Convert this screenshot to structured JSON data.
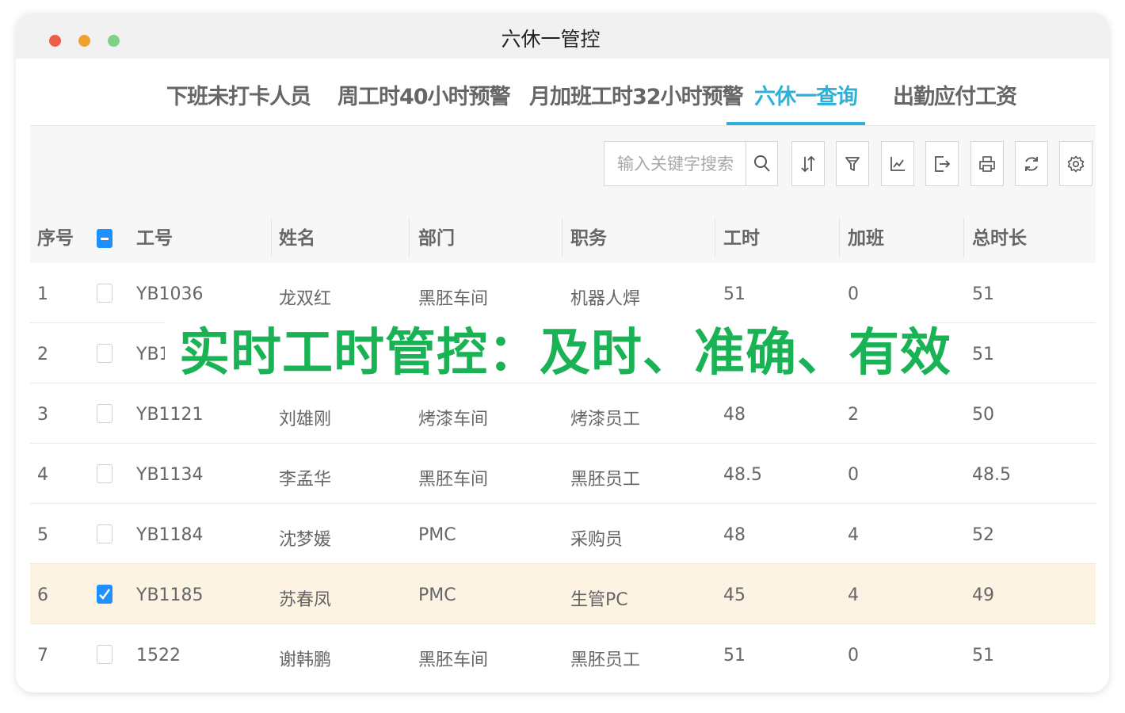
{
  "window": {
    "title": "六休一管控"
  },
  "tabs": [
    {
      "label": "下班未打卡人员",
      "active": false
    },
    {
      "label": "周工时40小时预警",
      "active": false
    },
    {
      "label": "月加班工时32小时预警",
      "active": false
    },
    {
      "label": "六休一查询",
      "active": true
    },
    {
      "label": "出勤应付工资",
      "active": false
    }
  ],
  "accent_color": "#2fb0d6",
  "toolbar": {
    "search_placeholder": "输入关键字搜索",
    "icons": [
      "search-icon",
      "sort-icon",
      "filter-icon",
      "chart-icon",
      "export-icon",
      "print-icon",
      "refresh-icon",
      "settings-icon"
    ]
  },
  "table": {
    "columns": [
      "序号",
      "工号",
      "姓名",
      "部门",
      "职务",
      "工时",
      "加班",
      "总时长"
    ],
    "header_checkbox": "partial",
    "rows": [
      {
        "seq": "1",
        "checked": false,
        "id": "YB1036",
        "name": "龙双红",
        "dept": "黑胚车间",
        "title": "机器人焊",
        "hours": "51",
        "overtime": "0",
        "total": "51"
      },
      {
        "seq": "2",
        "checked": false,
        "id": "YB1",
        "name": "",
        "dept": "",
        "title": "",
        "hours": "",
        "overtime": "",
        "total": "51"
      },
      {
        "seq": "3",
        "checked": false,
        "id": "YB1121",
        "name": "刘雄刚",
        "dept": "烤漆车间",
        "title": "烤漆员工",
        "hours": "48",
        "overtime": "2",
        "total": "50"
      },
      {
        "seq": "4",
        "checked": false,
        "id": "YB1134",
        "name": "李孟华",
        "dept": "黑胚车间",
        "title": "黑胚员工",
        "hours": "48.5",
        "overtime": "0",
        "total": "48.5"
      },
      {
        "seq": "5",
        "checked": false,
        "id": "YB1184",
        "name": "沈梦媛",
        "dept": "PMC",
        "title": "采购员",
        "hours": "48",
        "overtime": "4",
        "total": "52"
      },
      {
        "seq": "6",
        "checked": true,
        "id": "YB1185",
        "name": "苏春凤",
        "dept": "PMC",
        "title": "生管PC",
        "hours": "45",
        "overtime": "4",
        "total": "49"
      },
      {
        "seq": "7",
        "checked": false,
        "id": "1522",
        "name": "谢韩鹏",
        "dept": "黑胚车间",
        "title": "黑胚员工",
        "hours": "51",
        "overtime": "0",
        "total": "51"
      }
    ]
  },
  "overlay": {
    "text": "实时工时管控：及时、准确、有效",
    "color": "#19b356"
  }
}
